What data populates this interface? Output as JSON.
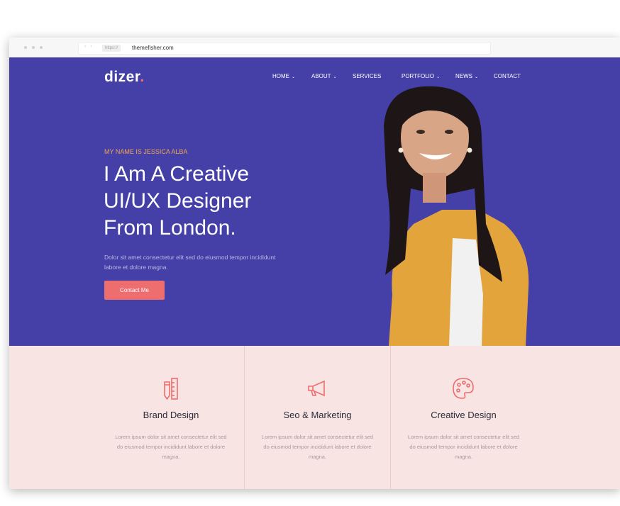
{
  "browser": {
    "protocol": "https://",
    "url": "themefisher.com",
    "nav_arrows": "‹ ›"
  },
  "site": {
    "logo_text": "dizer",
    "logo_dot": "."
  },
  "nav": {
    "items": [
      {
        "label": "HOME",
        "has_dropdown": true
      },
      {
        "label": "ABOUT",
        "has_dropdown": true
      },
      {
        "label": "SERVICES",
        "has_dropdown": false
      },
      {
        "label": "PORTFOLIO",
        "has_dropdown": true
      },
      {
        "label": "NEWS",
        "has_dropdown": true
      },
      {
        "label": "CONTACT",
        "has_dropdown": false
      }
    ],
    "dropdown_glyph": "⌄"
  },
  "hero": {
    "eyebrow": "MY NAME IS JESSICA ALBA",
    "headline_lines": [
      "I Am A Creative",
      "UI/UX Designer",
      "From London."
    ],
    "subtitle": "Dolor sit amet consectetur elit sed do eiusmod tempor incididunt labore et dolore magna.",
    "cta_label": "Contact Me"
  },
  "features": [
    {
      "icon": "pencil-ruler-icon",
      "title": "Brand Design",
      "text": "Lorem ipsum dolor sit amet consectetur elit sed do eiusmod tempor incididunt labore et dolore magna."
    },
    {
      "icon": "megaphone-icon",
      "title": "Seo & Marketing",
      "text": "Lorem ipsum dolor sit amet consectetur elit sed do eiusmod tempor incididunt labore et dolore magna."
    },
    {
      "icon": "palette-icon",
      "title": "Creative Design",
      "text": "Lorem ipsum dolor sit amet consectetur elit sed do eiusmod tempor incididunt labore et dolore magna."
    }
  ],
  "colors": {
    "hero_bg": "#4540a8",
    "accent": "#ee6d6e",
    "eyebrow": "#f2a64a",
    "features_bg": "#f9e4e4"
  }
}
